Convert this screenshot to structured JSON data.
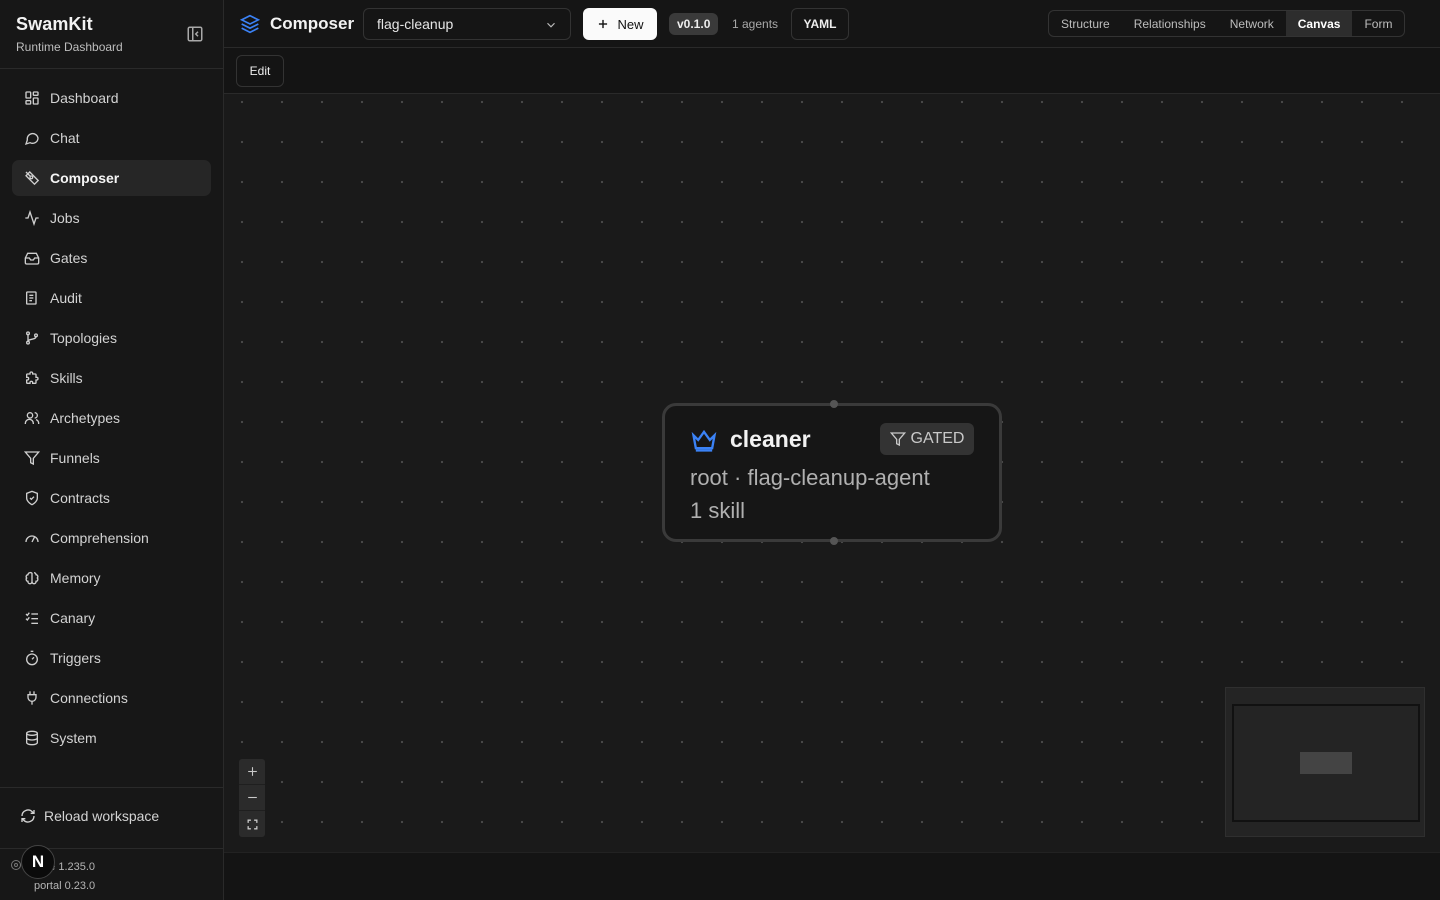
{
  "sidebar": {
    "brand": "SwamKit",
    "subtitle": "Runtime Dashboard",
    "items": [
      {
        "label": "Dashboard",
        "icon": "dashboard-icon"
      },
      {
        "label": "Chat",
        "icon": "chat-icon"
      },
      {
        "label": "Composer",
        "icon": "pen-nib-icon",
        "active": true
      },
      {
        "label": "Jobs",
        "icon": "activity-icon"
      },
      {
        "label": "Gates",
        "icon": "inbox-icon"
      },
      {
        "label": "Audit",
        "icon": "audit-icon"
      },
      {
        "label": "Topologies",
        "icon": "branch-icon"
      },
      {
        "label": "Skills",
        "icon": "puzzle-icon"
      },
      {
        "label": "Archetypes",
        "icon": "users-icon"
      },
      {
        "label": "Funnels",
        "icon": "funnel-icon"
      },
      {
        "label": "Contracts",
        "icon": "shield-check-icon"
      },
      {
        "label": "Comprehension",
        "icon": "gauge-icon"
      },
      {
        "label": "Memory",
        "icon": "brain-icon"
      },
      {
        "label": "Canary",
        "icon": "list-check-icon"
      },
      {
        "label": "Triggers",
        "icon": "timer-icon"
      },
      {
        "label": "Connections",
        "icon": "plug-icon"
      },
      {
        "label": "System",
        "icon": "database-icon"
      }
    ],
    "reload_label": "Reload workspace",
    "runtime_version": "me 1.235.0",
    "portal_version": "portal 0.23.0",
    "avatar_letter": "N"
  },
  "topbar": {
    "title": "Composer",
    "select_value": "flag-cleanup",
    "new_label": "New",
    "version_badge": "v0.1.0",
    "agents_count": "1 agents",
    "yaml_label": "YAML",
    "tabs": [
      {
        "label": "Structure"
      },
      {
        "label": "Relationships"
      },
      {
        "label": "Network"
      },
      {
        "label": "Canvas",
        "active": true
      },
      {
        "label": "Form"
      }
    ]
  },
  "toolbar": {
    "edit_label": "Edit"
  },
  "canvas": {
    "node": {
      "name": "cleaner",
      "badge": "GATED",
      "meta_line1": "root · flag-cleanup-agent",
      "meta_line2": "1 skill"
    }
  },
  "colors": {
    "accent": "#3b82f6",
    "background": "#141414",
    "active_item": "#262626"
  }
}
